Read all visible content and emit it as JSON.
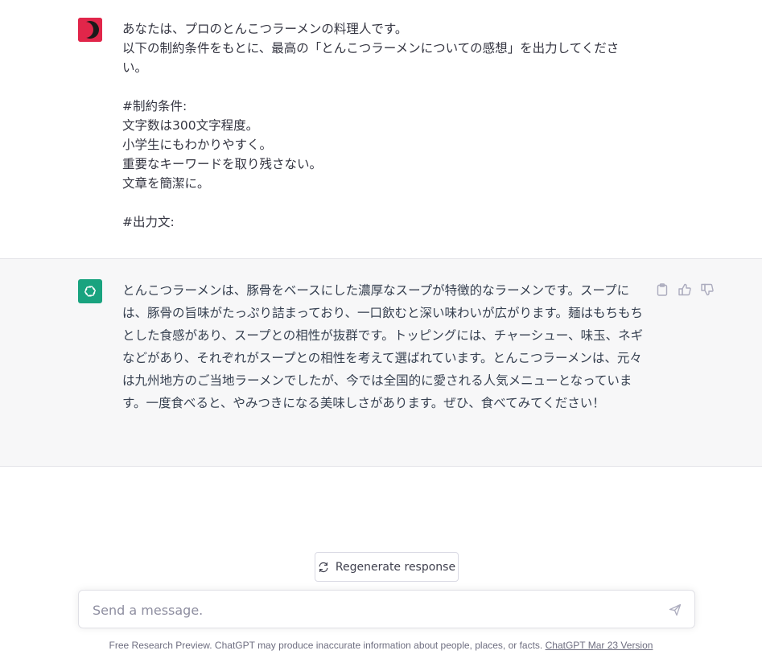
{
  "user_message": {
    "lines": [
      "あなたは、プロのとんこつラーメンの料理人です。",
      "以下の制約条件をもとに、最高の「とんこつラーメンについての感想」を出力してくださ",
      "い。",
      "",
      "#制約条件:",
      "文字数は300文字程度。",
      "小学生にもわかりやすく。",
      "重要なキーワードを取り残さない。",
      "文章を簡潔に。",
      "",
      "#出力文:"
    ]
  },
  "assistant_message": {
    "text": "とんこつラーメンは、豚骨をベースにした濃厚なスープが特徴的なラーメンです。スープには、豚骨の旨味がたっぷり詰まっており、一口飲むと深い味わいが広がります。麺はもちもちとした食感があり、スープとの相性が抜群です。トッピングには、チャーシュー、味玉、ネギなどがあり、それぞれがスープとの相性を考えて選ばれています。とんこつラーメンは、元々は九州地方のご当地ラーメンでしたが、今では全国的に愛される人気メニューとなっています。一度食べると、やみつきになる美味しさがあります。ぜひ、食べてみてください！"
  },
  "actions": {
    "copy_icon": "clipboard-icon",
    "like_icon": "thumbs-up-icon",
    "dislike_icon": "thumbs-down-icon"
  },
  "regenerate": {
    "label": "Regenerate response"
  },
  "input": {
    "placeholder": "Send a message."
  },
  "footer": {
    "text": "Free Research Preview. ChatGPT may produce inaccurate information about people, places, or facts. ",
    "link": "ChatGPT Mar 23 Version"
  },
  "colors": {
    "user_avatar": "#e1264a",
    "gpt_avatar": "#19a37f",
    "assistant_bg": "#f7f7f8"
  }
}
